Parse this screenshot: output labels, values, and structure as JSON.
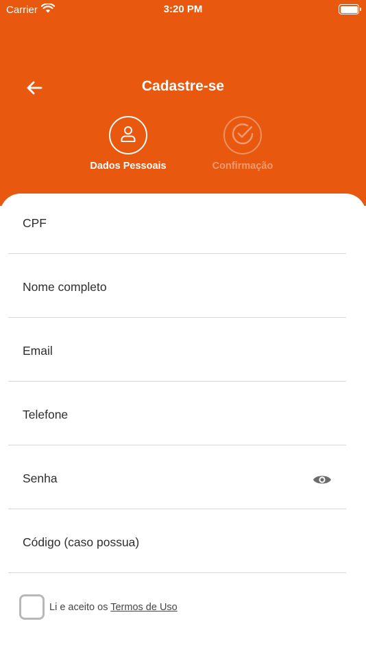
{
  "status_bar": {
    "carrier": "Carrier",
    "time": "3:20 PM",
    "icons": [
      "wifi-icon",
      "battery-icon"
    ]
  },
  "header": {
    "title": "Cadastre-se",
    "back_icon": "arrow-left-icon",
    "background_color": "#E8580E"
  },
  "steps": [
    {
      "label": "Dados Pessoais",
      "icon": "user-icon",
      "active": true
    },
    {
      "label": "Confirmação",
      "icon": "check-circle-icon",
      "active": false
    }
  ],
  "form": {
    "fields": [
      {
        "label": "CPF"
      },
      {
        "label": "Nome completo"
      },
      {
        "label": "Email"
      },
      {
        "label": "Telefone"
      },
      {
        "label": "Senha",
        "icon": "eye-icon"
      },
      {
        "label": "Código (caso possua)"
      }
    ]
  },
  "terms": {
    "checked": false,
    "prefix": "Li e aceito os ",
    "link": "Termos de Uso"
  }
}
